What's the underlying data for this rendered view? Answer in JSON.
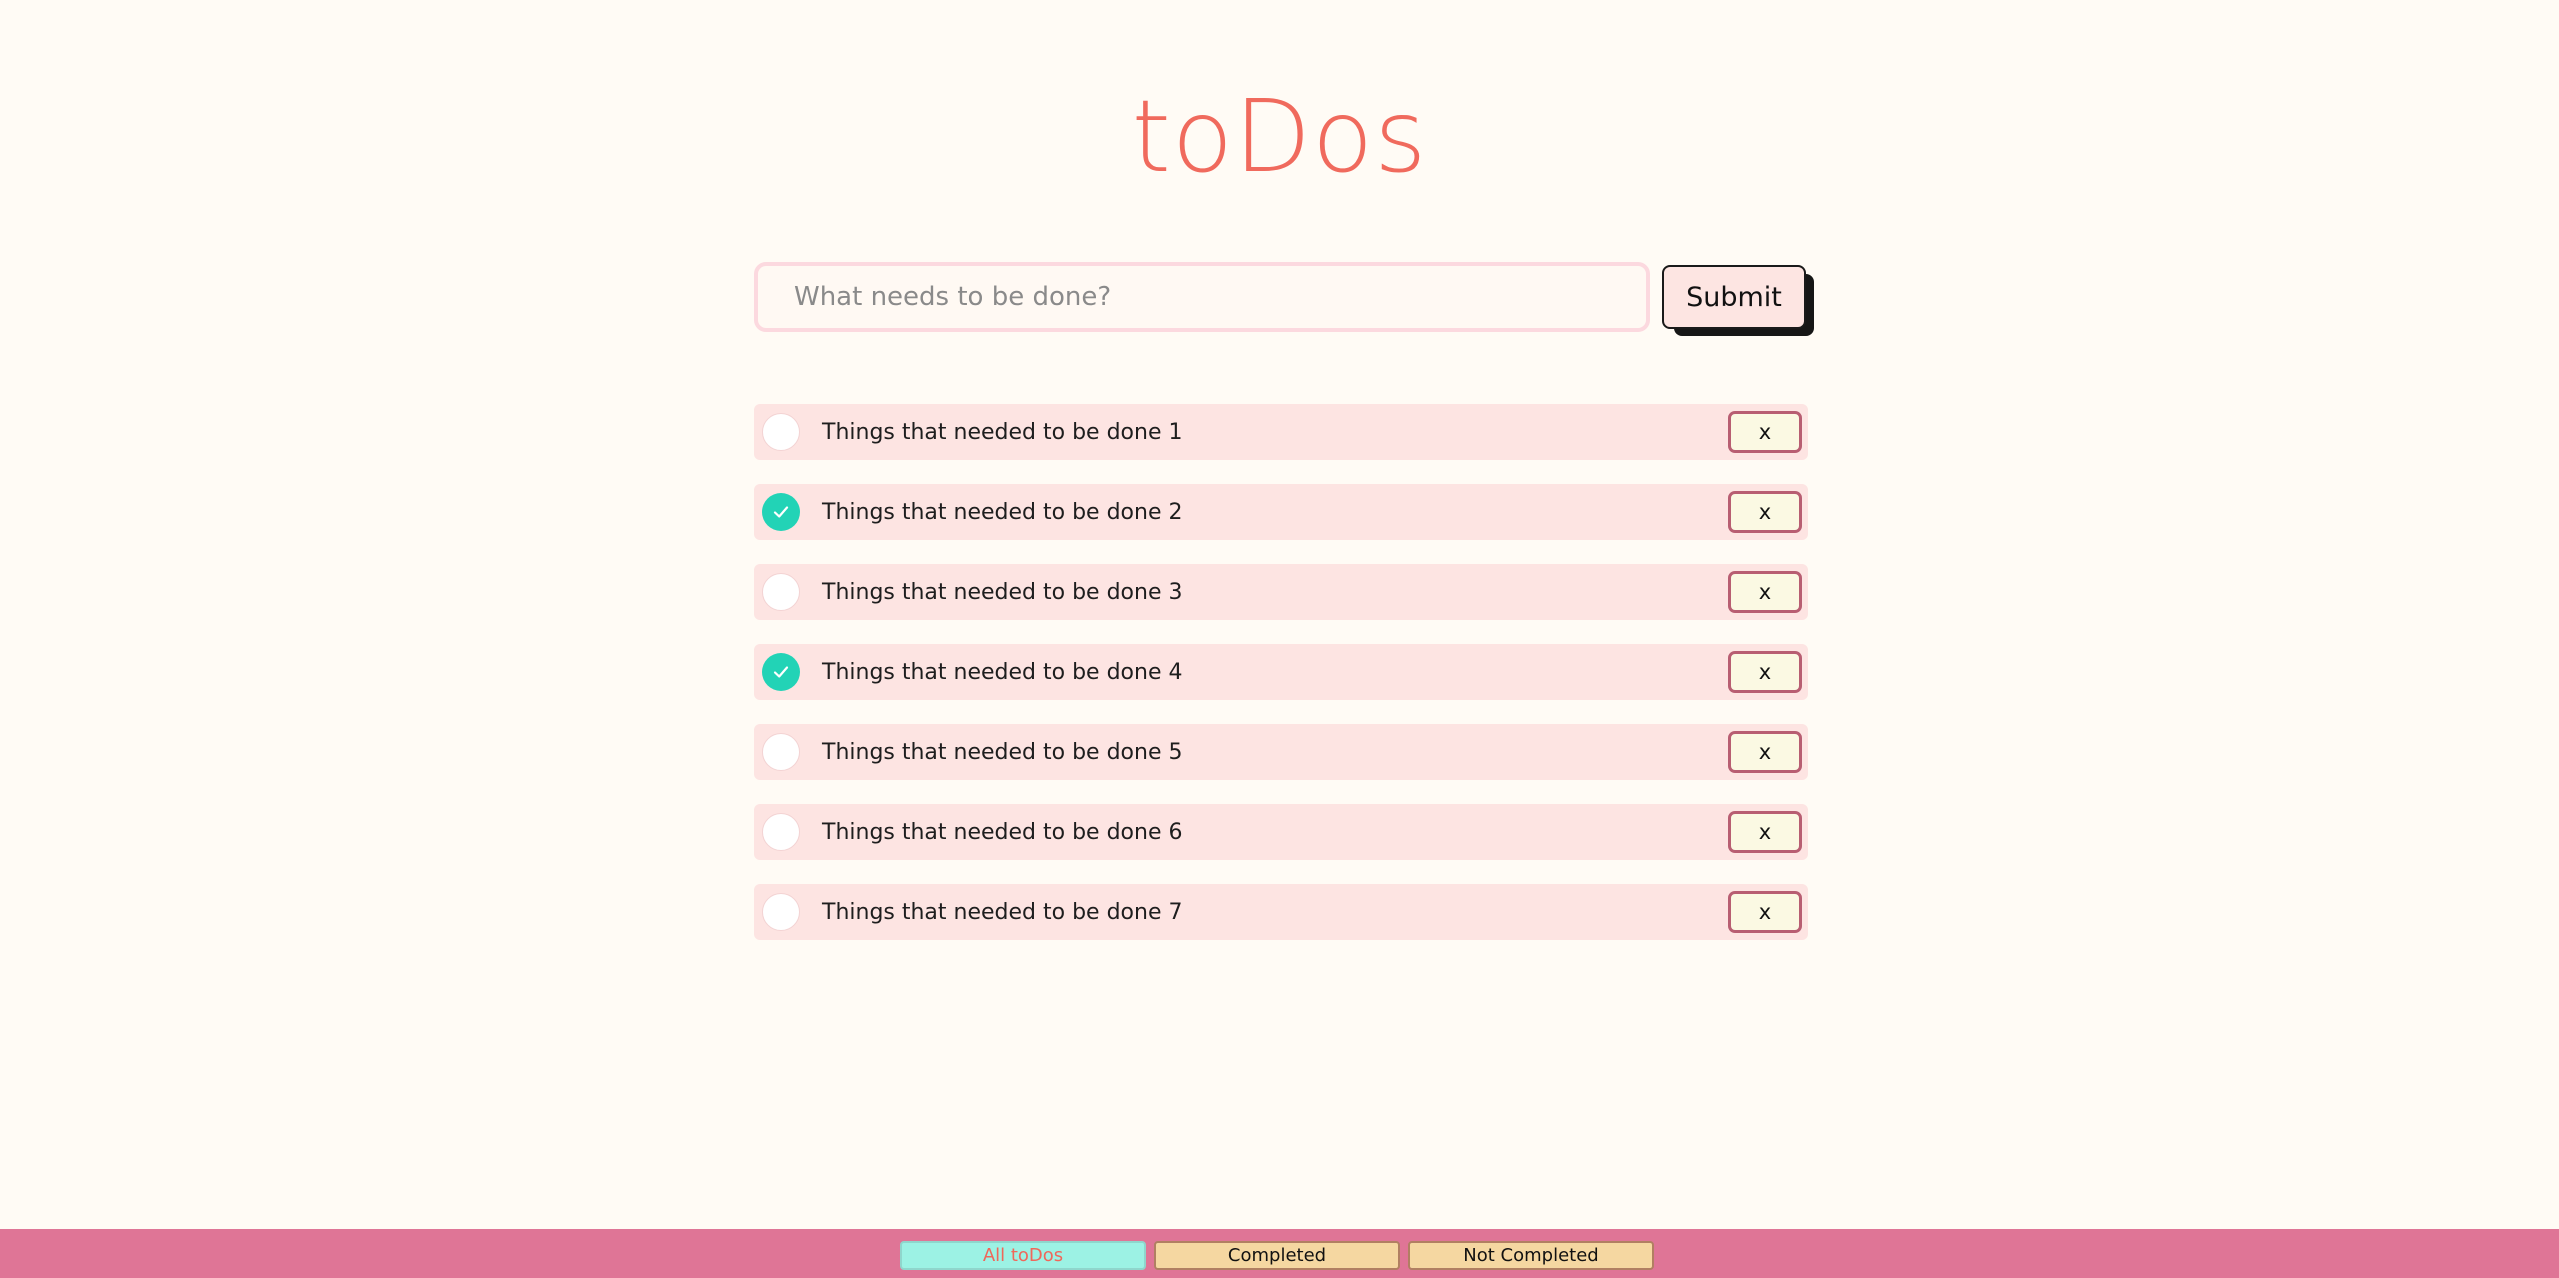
{
  "app": {
    "title": "toDos"
  },
  "input": {
    "placeholder": "What needs to be done?",
    "value": ""
  },
  "submit_label": "Submit",
  "todos": [
    {
      "text": "Things that needed to be done 1",
      "completed": false,
      "delete_label": "x"
    },
    {
      "text": "Things that needed to be done 2",
      "completed": true,
      "delete_label": "x"
    },
    {
      "text": "Things that needed to be done 3",
      "completed": false,
      "delete_label": "x"
    },
    {
      "text": "Things that needed to be done 4",
      "completed": true,
      "delete_label": "x"
    },
    {
      "text": "Things that needed to be done 5",
      "completed": false,
      "delete_label": "x"
    },
    {
      "text": "Things that needed to be done 6",
      "completed": false,
      "delete_label": "x"
    },
    {
      "text": "Things that needed to be done 7",
      "completed": false,
      "delete_label": "x"
    }
  ],
  "filters": [
    {
      "label": "All toDos",
      "active": true
    },
    {
      "label": "Completed",
      "active": false
    },
    {
      "label": "Not Completed",
      "active": false
    }
  ],
  "colors": {
    "background": "#fffbf5",
    "title": "#f06a5d",
    "todo_bg": "#fde4e2",
    "check_done": "#22d3b6",
    "footer": "#df7596",
    "filter_active": "#9cf2e4",
    "filter_inactive": "#f5d7a1"
  },
  "icons": {
    "checkmark": "check-icon"
  }
}
